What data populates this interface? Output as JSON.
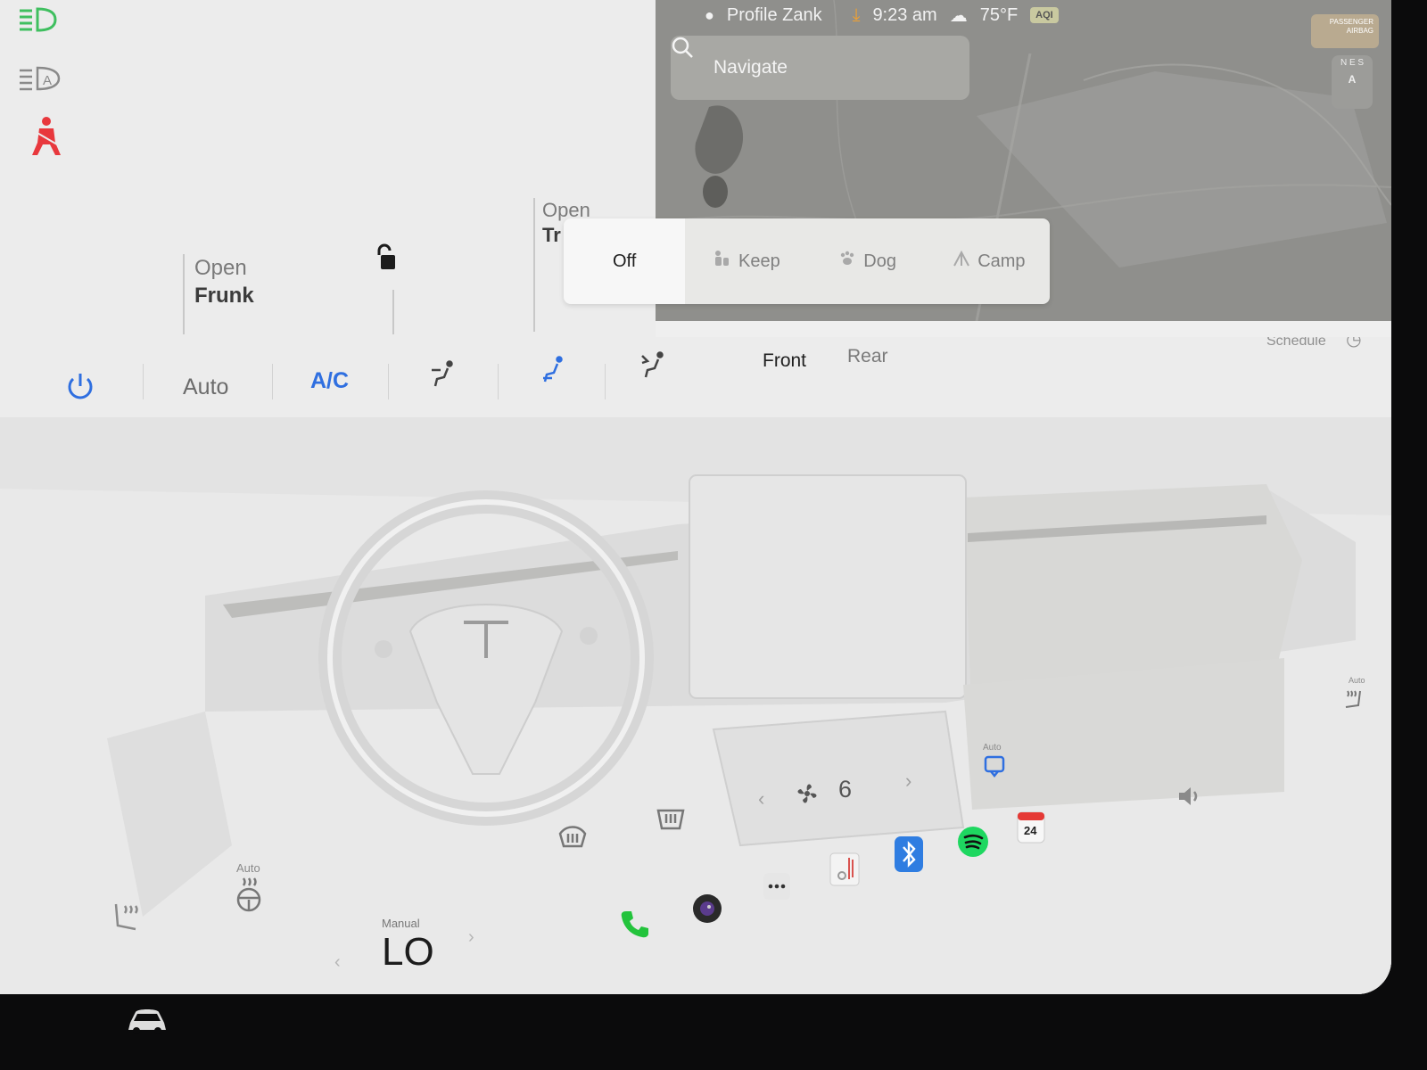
{
  "status": {
    "profile": "Profile Zank",
    "time": "9:23 am",
    "temperature": "75°F",
    "aqi": "AQI",
    "airbag_label": "PASSENGER AIRBAG"
  },
  "navigate": {
    "placeholder": "Navigate"
  },
  "compass": {
    "letters": "N E S",
    "mode": "A"
  },
  "frunk": {
    "line1": "Open",
    "line2": "Frunk"
  },
  "trunk": {
    "line1": "Open",
    "line2": "Tr"
  },
  "climate_modes": {
    "off": "Off",
    "keep": "Keep",
    "dog": "Dog",
    "camp": "Camp"
  },
  "climate": {
    "auto_label": "Auto",
    "ac_label": "A/C",
    "front_label": "Front",
    "rear_label": "Rear",
    "schedule_label": "Schedule",
    "fan_speed": "6",
    "temp_mode_label": "Manual",
    "temp_value": "LO",
    "seat_auto_label": "Auto",
    "right_seat_auto_label": "Auto",
    "recirc_auto_label": "Auto"
  },
  "calendar": {
    "day": "24"
  },
  "colors": {
    "accent_blue": "#2f6fe0",
    "warning_red": "#e8383d",
    "lights_green": "#3fbf5f",
    "phone_green": "#23c33c",
    "spotify_green": "#1ed760"
  }
}
